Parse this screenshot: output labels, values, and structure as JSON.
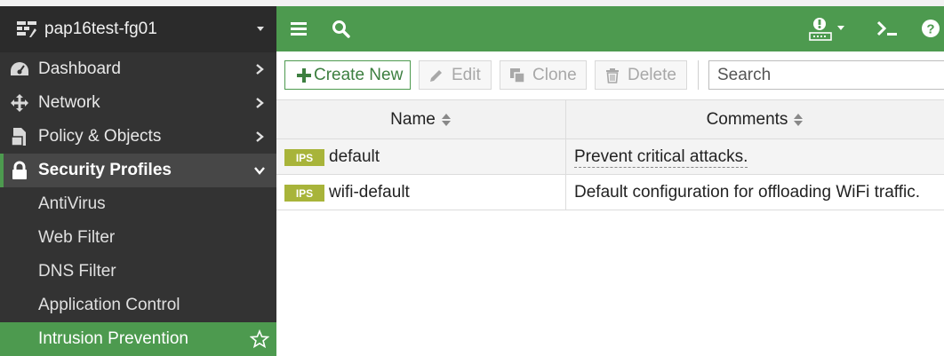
{
  "device": {
    "name": "pap16test-fg01",
    "icon": "device-switch-icon"
  },
  "sidebar": {
    "items": [
      {
        "label": "Dashboard",
        "icon": "dashboard-gauge-icon"
      },
      {
        "label": "Network",
        "icon": "move-arrows-icon"
      },
      {
        "label": "Policy & Objects",
        "icon": "policy-document-icon"
      },
      {
        "label": "Security Profiles",
        "icon": "lock-icon",
        "expanded": true
      }
    ],
    "security_sub": [
      {
        "label": "AntiVirus"
      },
      {
        "label": "Web Filter"
      },
      {
        "label": "DNS Filter"
      },
      {
        "label": "Application Control"
      },
      {
        "label": "Intrusion Prevention",
        "selected": true
      }
    ]
  },
  "topbar": {
    "icons": [
      "menu-icon",
      "search-icon",
      "alert-icon",
      "cli-icon",
      "help-icon"
    ]
  },
  "toolbar": {
    "create_label": "Create New",
    "edit_label": "Edit",
    "clone_label": "Clone",
    "delete_label": "Delete",
    "search_placeholder": "Search"
  },
  "table": {
    "columns": [
      "Name",
      "Comments"
    ],
    "rows": [
      {
        "badge": "IPS",
        "name": "default",
        "comment": "Prevent critical attacks."
      },
      {
        "badge": "IPS",
        "name": "wifi-default",
        "comment": "Default configuration for offloading WiFi traffic."
      }
    ]
  },
  "colors": {
    "accent": "#4d9a4f",
    "sidebar_bg": "#333333",
    "badge": "#a8b43a"
  }
}
